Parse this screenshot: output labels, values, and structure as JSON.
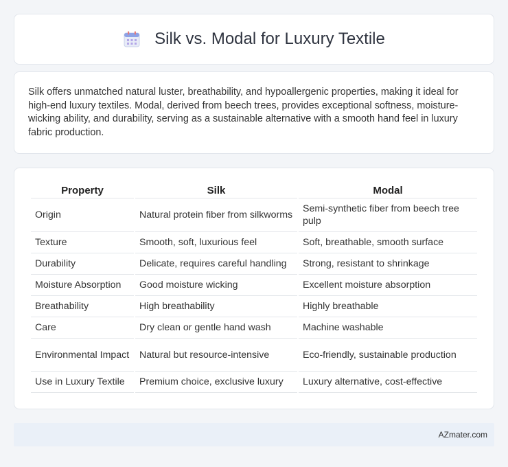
{
  "header": {
    "title": "Silk vs. Modal for Luxury Textile",
    "icon": "calendar-icon"
  },
  "intro": {
    "text": "Silk offers unmatched natural luster, breathability, and hypoallergenic properties, making it ideal for high-end luxury textiles. Modal, derived from beech trees, provides exceptional softness, moisture-wicking ability, and durability, serving as a sustainable alternative with a smooth hand feel in luxury fabric production."
  },
  "table": {
    "headers": [
      "Property",
      "Silk",
      "Modal"
    ],
    "rows": [
      [
        "Origin",
        "Natural protein fiber from silkworms",
        "Semi-synthetic fiber from beech tree pulp"
      ],
      [
        "Texture",
        "Smooth, soft, luxurious feel",
        "Soft, breathable, smooth surface"
      ],
      [
        "Durability",
        "Delicate, requires careful handling",
        "Strong, resistant to shrinkage"
      ],
      [
        "Moisture Absorption",
        "Good moisture wicking",
        "Excellent moisture absorption"
      ],
      [
        "Breathability",
        "High breathability",
        "Highly breathable"
      ],
      [
        "Care",
        "Dry clean or gentle hand wash",
        "Machine washable"
      ],
      [
        "Environmental Impact",
        "Natural but resource-intensive",
        "Eco-friendly, sustainable production"
      ],
      [
        "Use in Luxury Textile",
        "Premium choice, exclusive luxury",
        "Luxury alternative, cost-effective"
      ]
    ]
  },
  "footer": {
    "brand": "AZmater.com"
  }
}
